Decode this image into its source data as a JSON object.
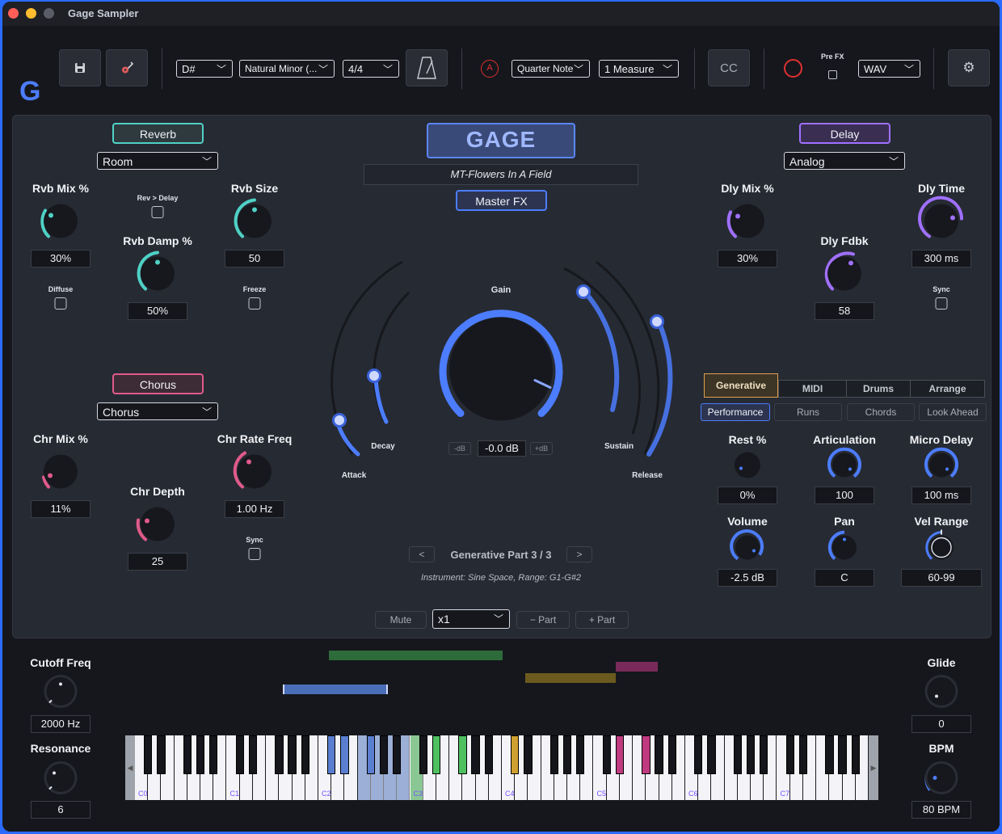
{
  "window": {
    "title": "Gage Sampler"
  },
  "toolbar": {
    "logo": "G",
    "save_icon": "floppy-disk-icon",
    "guitar_icon": "guitar-icon",
    "key": "D#",
    "scale": "Natural Minor (...",
    "time_signature": "4/4",
    "metronome_icon": "metronome-icon",
    "quantize": "Quarter Note",
    "length": "1 Measure",
    "cc_label": "CC",
    "pre_fx_label": "Pre FX",
    "format": "WAV",
    "settings_icon": "gear-icon"
  },
  "reverb": {
    "title": "Reverb",
    "type": "Room",
    "mix_label": "Rvb Mix %",
    "mix_value": "30%",
    "rev_delay_label": "Rev > Delay",
    "size_label": "Rvb Size",
    "size_value": "50",
    "damp_label": "Rvb Damp %",
    "damp_value": "50%",
    "diffuse_label": "Diffuse",
    "freeze_label": "Freeze"
  },
  "chorus": {
    "title": "Chorus",
    "type": "Chorus",
    "mix_label": "Chr Mix %",
    "mix_value": "11%",
    "rate_label": "Chr Rate Freq",
    "rate_value": "1.00 Hz",
    "depth_label": "Chr Depth",
    "depth_value": "25",
    "sync_label": "Sync"
  },
  "center": {
    "brand": "GAGE",
    "preset": "MT-Flowers In A Field",
    "master_fx": "Master FX",
    "gain_label": "Gain",
    "gain_value": "-0.0 dB",
    "minus_db": "-dB",
    "plus_db": "+dB",
    "attack_label": "Attack",
    "decay_label": "Decay",
    "sustain_label": "Sustain",
    "release_label": "Release",
    "part_prev": "<",
    "part_next": ">",
    "part_label": "Generative Part 3 / 3",
    "instrument_info": "Instrument: Sine Space, Range: G1-G#2",
    "mute": "Mute",
    "multiplier": "x1",
    "minus_part": "− Part",
    "plus_part": "+ Part"
  },
  "delay": {
    "title": "Delay",
    "type": "Analog",
    "mix_label": "Dly Mix %",
    "mix_value": "30%",
    "time_label": "Dly Time",
    "time_value": "300 ms",
    "fdbk_label": "Dly Fdbk",
    "fdbk_value": "58",
    "sync_label": "Sync"
  },
  "tabs": [
    "Generative",
    "MIDI",
    "Drums",
    "Arrange"
  ],
  "subtabs": [
    "Performance",
    "Runs",
    "Chords",
    "Look Ahead"
  ],
  "perf": {
    "rest_label": "Rest %",
    "rest_value": "0%",
    "artic_label": "Articulation",
    "artic_value": "100",
    "micro_label": "Micro Delay",
    "micro_value": "100 ms",
    "volume_label": "Volume",
    "volume_value": "-2.5 dB",
    "pan_label": "Pan",
    "pan_value": "C",
    "vel_label": "Vel Range",
    "vel_value": "60-99"
  },
  "bottom": {
    "cutoff_label": "Cutoff Freq",
    "cutoff_value": "2000 Hz",
    "res_label": "Resonance",
    "res_value": "6",
    "glide_label": "Glide",
    "glide_value": "0",
    "bpm_label": "BPM",
    "bpm_value": "80 BPM",
    "octaves": [
      "C0",
      "C1",
      "C2",
      "C3",
      "C4",
      "C5",
      "C6",
      "C7"
    ]
  },
  "colors": {
    "accent": "#4c7dff",
    "teal": "#4fd1c5",
    "pink": "#e05a8a",
    "purple": "#a070ff"
  }
}
